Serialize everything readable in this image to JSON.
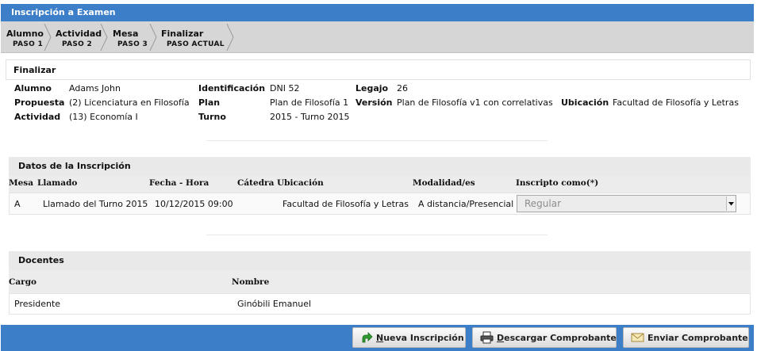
{
  "window": {
    "title": "Inscripción a Examen"
  },
  "steps": [
    {
      "name": "Alumno",
      "sub": "PASO 1"
    },
    {
      "name": "Actividad",
      "sub": "PASO 2"
    },
    {
      "name": "Mesa",
      "sub": "PASO 3"
    },
    {
      "name": "Finalizar",
      "sub": "PASO ACTUAL"
    }
  ],
  "summary": {
    "heading": "Finalizar",
    "alumno_label": "Alumno",
    "alumno_value": "Adams John",
    "identificacion_label": "Identificación",
    "identificacion_value": "DNI 52",
    "legajo_label": "Legajo",
    "legajo_value": "26",
    "propuesta_label": "Propuesta",
    "propuesta_value": "(2) Licenciatura en Filosofía",
    "plan_label": "Plan",
    "plan_value": "Plan de Filosofía 1",
    "version_label": "Versión",
    "version_value": "Plan de Filosofía v1 con correlativas",
    "ubicacion_label": "Ubicación",
    "ubicacion_value": "Facultad de Filosofía y Letras",
    "actividad_label": "Actividad",
    "actividad_value": "(13) Economía I",
    "turno_label": "Turno",
    "turno_value": "2015 - Turno 2015"
  },
  "inscripcion": {
    "heading": "Datos de la Inscripción",
    "columns": [
      "Mesa",
      "Llamado",
      "Fecha - Hora",
      "Cátedra",
      "Ubicación",
      "Modalidad/es",
      "Inscripto como(*)"
    ],
    "row": {
      "mesa": "A",
      "llamado": "Llamado del Turno 2015",
      "fecha_hora": "10/12/2015 09:00",
      "catedra": "",
      "ubicacion": "Facultad de Filosofía y Letras",
      "modalidad": "A distancia/Presencial",
      "inscripto_como": "Regular"
    }
  },
  "docentes": {
    "heading": "Docentes",
    "columns": [
      "Cargo",
      "Nombre"
    ],
    "rows": [
      {
        "cargo": "Presidente",
        "nombre": "Ginóbili Emanuel"
      }
    ]
  },
  "buttons": {
    "nueva_first": "N",
    "nueva_rest": "ueva Inscripción",
    "descargar_first": "D",
    "descargar_rest": "escargar Comprobante",
    "enviar": "Enviar Comprobante"
  },
  "icons": {
    "nueva": "green-arrow-icon",
    "descargar": "printer-icon",
    "enviar": "envelope-icon",
    "select": "chevron-down-icon"
  },
  "colors": {
    "accent": "#3d7ec9",
    "stepbar": "#d6d6d6",
    "section": "#e9e9e9"
  }
}
